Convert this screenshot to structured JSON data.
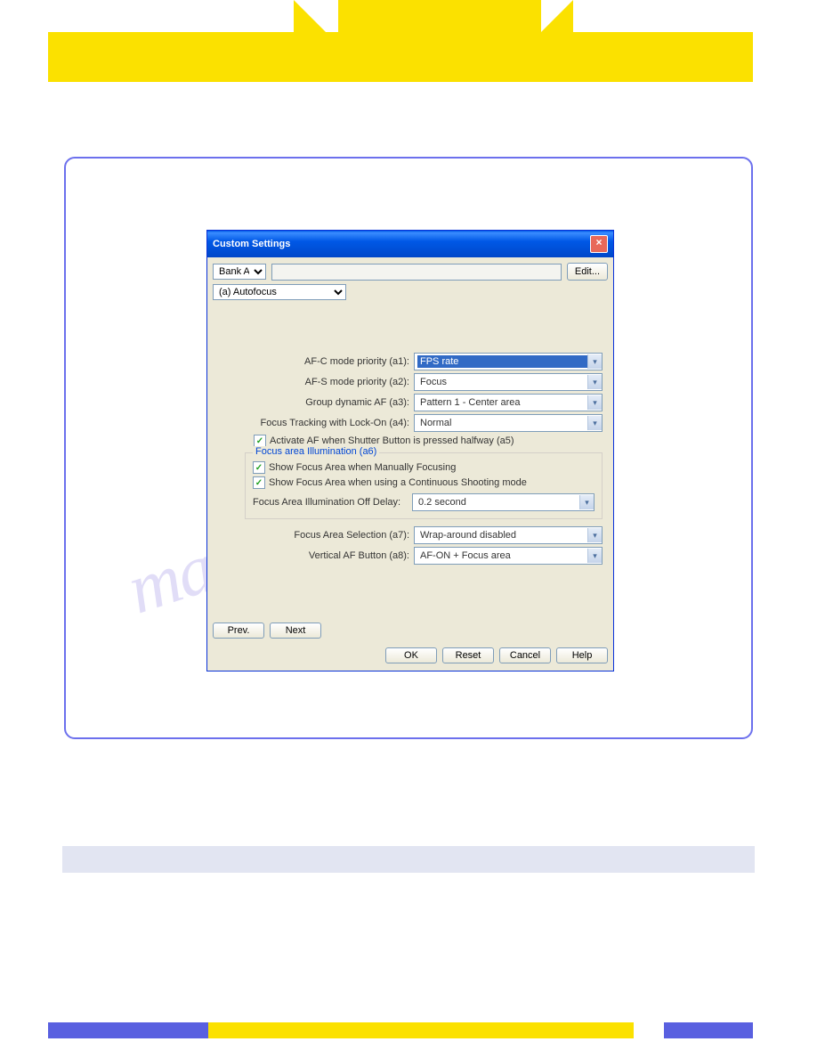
{
  "dialog": {
    "title": "Custom Settings",
    "bank": "Bank A",
    "category": "(a) Autofocus",
    "edit": "Edit...",
    "rows": {
      "a1": {
        "label": "AF-C mode priority (a1):",
        "value": "FPS rate",
        "selected": true
      },
      "a2": {
        "label": "AF-S mode priority (a2):",
        "value": "Focus"
      },
      "a3": {
        "label": "Group dynamic AF (a3):",
        "value": "Pattern 1 - Center area"
      },
      "a4": {
        "label": "Focus Tracking with Lock-On (a4):",
        "value": "Normal"
      },
      "a5": "Activate AF when Shutter Button is pressed halfway (a5)",
      "a6": {
        "legend": "Focus area Illumination (a6)",
        "c1": "Show Focus Area when Manually Focusing",
        "c2": "Show Focus Area when using a Continuous Shooting mode",
        "dlabel": "Focus Area Illumination Off Delay:",
        "dval": "0.2 second"
      },
      "a7": {
        "label": "Focus Area Selection (a7):",
        "value": "Wrap-around disabled"
      },
      "a8": {
        "label": "Vertical AF Button (a8):",
        "value": "AF-ON + Focus area"
      }
    },
    "nav": {
      "prev": "Prev.",
      "next": "Next"
    },
    "buttons": {
      "ok": "OK",
      "reset": "Reset",
      "cancel": "Cancel",
      "help": "Help"
    }
  },
  "watermark": "manualshive.com"
}
